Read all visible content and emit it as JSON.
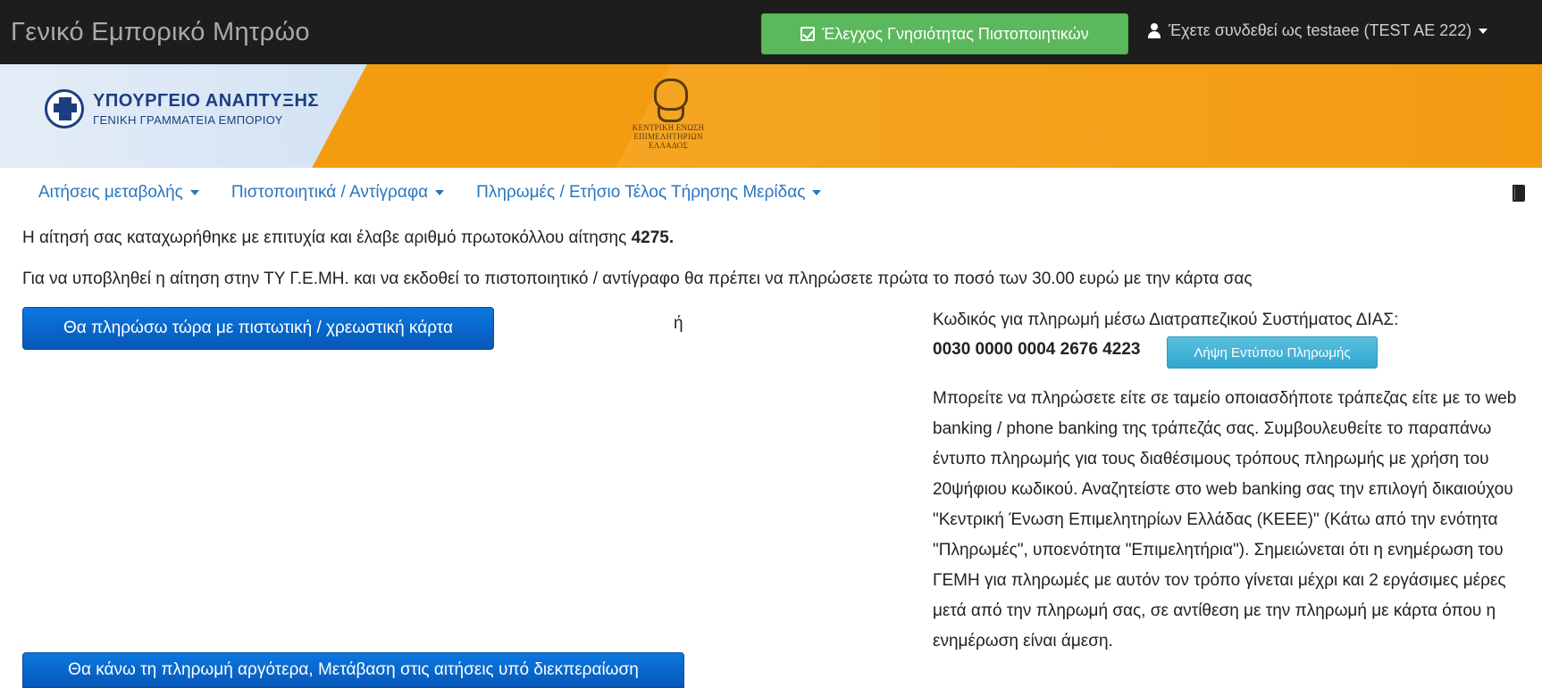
{
  "app": {
    "title": "Γενικό Εμπορικό Μητρώο",
    "verify_button": "Έλεγχος Γνησιότητας Πιστοποιητικών",
    "user_menu": "Έχετε συνδεθεί ως testaee (TEST AE 222)"
  },
  "banner": {
    "ministry_line1": "ΥΠΟΥΡΓΕΙΟ ΑΝΑΠΤΥΞΗΣ",
    "ministry_line2": "ΓΕΝΙΚΗ ΓΡΑΜΜΑΤΕΙΑ ΕΜΠΟΡΙΟΥ",
    "chamber_line1": "ΚΕΝΤΡΙΚΗ ΕΝΩΣΗ",
    "chamber_line2": "ΕΠΙΜΕΛΗΤΗΡΙΩΝ",
    "chamber_line3": "ΕΛΛΑΔΟΣ"
  },
  "subnav": {
    "items": [
      {
        "label": "Αιτήσεις μεταβολής"
      },
      {
        "label": "Πιστοποιητικά / Αντίγραφα"
      },
      {
        "label": "Πληρωμές / Ετήσιο Τέλος Τήρησης Μερίδας"
      }
    ]
  },
  "messages": {
    "success_prefix": "Η αίτησή σας καταχωρήθηκε με επιτυχία και έλαβε αριθμό πρωτοκόλλου αίτησης ",
    "protocol_number": "4275.",
    "payment_notice": "Για να υποβληθεί η αίτηση στην ΤΥ Γ.Ε.ΜΗ. και να εκδοθεί το πιστοποιητικό / αντίγραφο θα πρέπει να πληρώσετε πρώτα το ποσό των 30.00 ευρώ με την κάρτα σας"
  },
  "actions": {
    "pay_now": "Θα πληρώσω τώρα με πιστωτική / χρεωστική κάρτα",
    "or": "ή",
    "pay_later": "Θα κάνω τη πληρωμή αργότερα, Μετάβαση στις αιτήσεις υπό διεκπεραίωση"
  },
  "dias": {
    "label": "Κωδικός για πληρωμή μέσω Διατραπεζικού Συστήματος ΔΙΑΣ:",
    "code": "0030 0000 0004 2676 4223",
    "print_button": "Λήψη Εντύπου Πληρωμής",
    "info": "Μπορείτε να πληρώσετε είτε σε ταμείο οποιασδήποτε τράπεζας είτε με το web banking / phone banking της τράπεζάς σας. Συμβουλευθείτε το παραπάνω έντυπο πληρωμής για τους διαθέσιμους τρόπους πληρωμής με χρήση του 20ψήφιου κωδικού. Αναζητείστε στο web banking σας την επιλογή δικαιούχου \"Κεντρική Ένωση Επιμελητηρίων Ελλάδας (ΚΕΕΕ)\" (Κάτω από την ενότητα \"Πληρωμές\", υποενότητα \"Επιμελητήρια\"). Σημειώνεται ότι η ενημέρωση του ΓΕΜΗ για πληρωμές με αυτόν τον τρόπο γίνεται μέχρι και 2 εργάσιμες μέρες μετά από την πληρωμή σας, σε αντίθεση με την πληρωμή με κάρτα όπου η ενημέρωση είναι άμεση."
  },
  "icons": {
    "verify": "check-square-icon",
    "user": "user-icon",
    "menu_caret": "caret-down-icon",
    "manual": "book-icon"
  },
  "colors": {
    "navbar": "#1d1d1d",
    "verify_green": "#5cb85c",
    "primary_blue": "#0a6fd6",
    "info_blue": "#5bc0de",
    "link_blue": "#2a76be",
    "banner_orange": "#f39c12",
    "banner_lightblue": "#d4e3f4"
  }
}
